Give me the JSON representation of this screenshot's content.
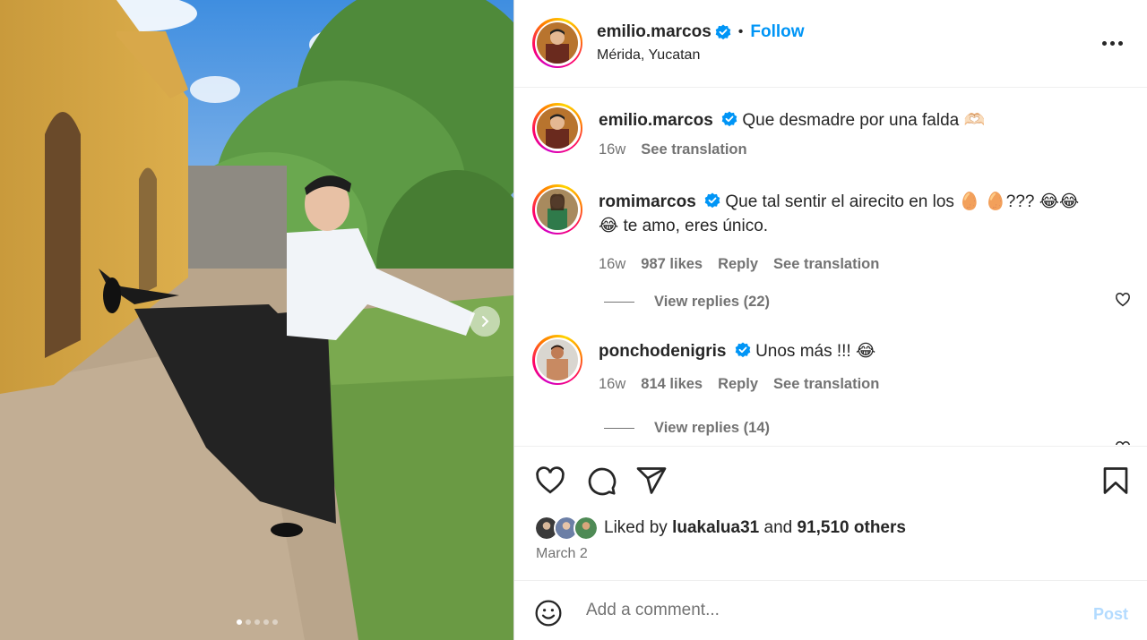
{
  "post": {
    "username": "emilio.marcos",
    "verified_icon": "verified-badge-icon",
    "separator": "•",
    "follow_label": "Follow",
    "location": "Mérida, Yucatan",
    "media_carousel": {
      "slide_count": 5,
      "active_slide": 1
    }
  },
  "caption": {
    "username": "emilio.marcos",
    "text": "Que desmadre por una falda 🫶🏻",
    "age": "16w",
    "see_translation": "See translation"
  },
  "comments": [
    {
      "username": "romimarcos",
      "text_line1": "Que tal sentir el airecito en los 🥚 🥚??? 😂😂",
      "text_line2": "😂 te amo, eres único.",
      "age": "16w",
      "likes": "987 likes",
      "reply": "Reply",
      "see_translation": "See translation",
      "view_replies": "View replies (22)"
    },
    {
      "username": "ponchodenigris",
      "text_line1": "Unos más !!! 😂",
      "age": "16w",
      "likes": "814 likes",
      "reply": "Reply",
      "see_translation": "See translation",
      "view_replies": "View replies (14)"
    }
  ],
  "likes": {
    "prefix": "Liked by",
    "user": "luakalua31",
    "joiner": "and",
    "others": "91,510 others",
    "date": "March 2"
  },
  "composer": {
    "placeholder": "Add a comment...",
    "post_label": "Post"
  },
  "colors": {
    "accent": "#0095f6",
    "post_disabled": "#b3dbff",
    "secondary_text": "#737373",
    "primary_text": "#262626"
  }
}
